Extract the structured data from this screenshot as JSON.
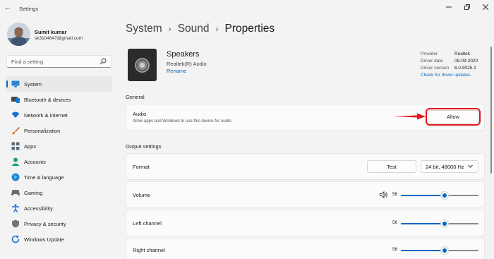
{
  "window": {
    "back_glyph": "←",
    "title": "Settings"
  },
  "user": {
    "name": "Sumit kumar",
    "email": "sk3104647@gmail.com"
  },
  "search": {
    "placeholder": "Find a setting"
  },
  "nav": [
    {
      "label": "System",
      "icon": "monitor-icon",
      "active": true
    },
    {
      "label": "Bluetooth & devices",
      "icon": "bluetooth-icon"
    },
    {
      "label": "Network & internet",
      "icon": "wifi-icon"
    },
    {
      "label": "Personalization",
      "icon": "brush-icon"
    },
    {
      "label": "Apps",
      "icon": "apps-icon"
    },
    {
      "label": "Accounts",
      "icon": "person-icon"
    },
    {
      "label": "Time & language",
      "icon": "globe-icon"
    },
    {
      "label": "Gaming",
      "icon": "gamepad-icon"
    },
    {
      "label": "Accessibility",
      "icon": "accessibility-icon"
    },
    {
      "label": "Privacy & security",
      "icon": "shield-icon"
    },
    {
      "label": "Windows Update",
      "icon": "update-icon"
    }
  ],
  "breadcrumb": {
    "items": [
      "System",
      "Sound"
    ],
    "separator": "›",
    "current": "Properties"
  },
  "device": {
    "name": "Speakers",
    "subtitle": "Realtek(R) Audio",
    "rename": "Rename"
  },
  "properties": {
    "provider_label": "Provider",
    "provider_value": "Realtek",
    "date_label": "Driver date",
    "date_value": "08-09-2020",
    "version_label": "Driver version",
    "version_value": "6.0.9025.1",
    "updates_link": "Check for driver updates"
  },
  "general": {
    "header": "General",
    "audio_title": "Audio",
    "audio_desc": "Allow apps and Windows to use this device for audio",
    "allow_button": "Allow"
  },
  "output": {
    "header": "Output settings",
    "format_label": "Format",
    "test_button": "Test",
    "format_value": "24 bit, 48000 Hz",
    "volume_label": "Volume",
    "volume_value": "56",
    "left_label": "Left channel",
    "left_value": "56",
    "right_label": "Right channel",
    "right_value": "56"
  },
  "colors": {
    "accent": "#0067c0",
    "highlight": "#e3151a"
  }
}
